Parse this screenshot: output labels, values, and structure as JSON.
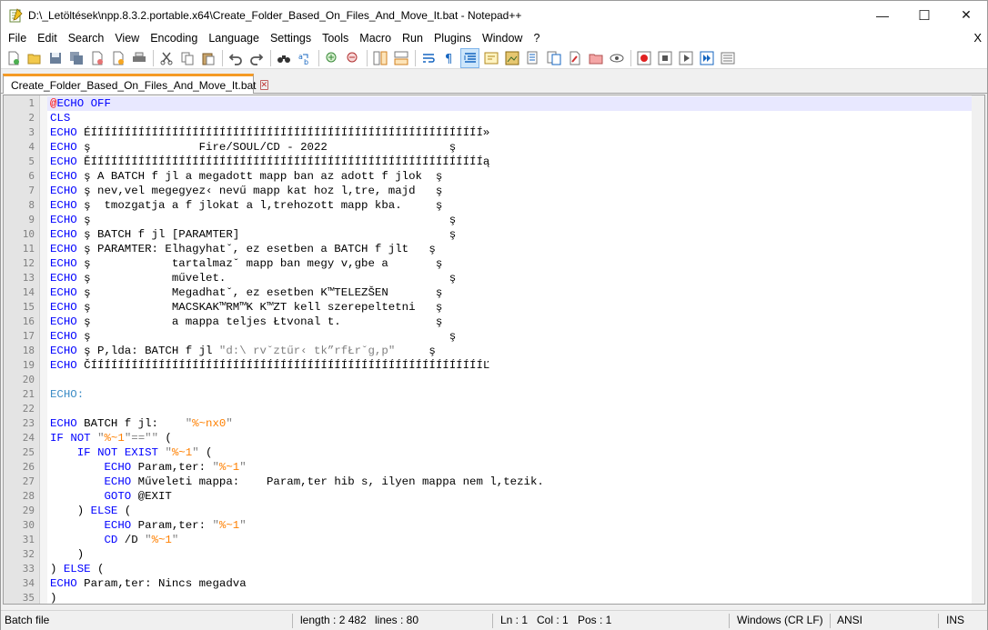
{
  "window": {
    "title": "D:\\_Letöltések\\npp.8.3.2.portable.x64\\Create_Folder_Based_On_Files_And_Move_It.bat - Notepad++",
    "minimize_glyph": "—",
    "maximize_glyph": "☐",
    "close_glyph": "✕"
  },
  "menu": {
    "items": [
      "File",
      "Edit",
      "Search",
      "View",
      "Encoding",
      "Language",
      "Settings",
      "Tools",
      "Macro",
      "Run",
      "Plugins",
      "Window",
      "?"
    ],
    "close_label": "X"
  },
  "toolbar": {
    "buttons": [
      "new",
      "open",
      "save",
      "save-all",
      "close",
      "close-all",
      "print",
      "cut",
      "copy",
      "paste",
      "undo",
      "redo",
      "find",
      "replace",
      "zoom-in",
      "zoom-out",
      "sync-v",
      "sync-h",
      "word-wrap",
      "all-chars",
      "indent-guide",
      "udl",
      "doc-map",
      "doc-list",
      "function-list",
      "folder-workspace",
      "monitoring",
      "record-macro",
      "stop-macro",
      "play-macro",
      "run-macro-multiple",
      "save-macro"
    ]
  },
  "tab": {
    "label": "Create_Folder_Based_On_Files_And_Move_It.bat",
    "close_glyph": "✕"
  },
  "editor": {
    "lines": [
      "@ECHO OFF",
      "CLS",
      "ECHO ÉÍÍÍÍÍÍÍÍÍÍÍÍÍÍÍÍÍÍÍÍÍÍÍÍÍÍÍÍÍÍÍÍÍÍÍÍÍÍÍÍÍÍÍÍÍÍÍÍÍÍÍÍÍÍÍÍÍÍ»",
      "ECHO ş                Fire/SOUL/CD - 2022                  ş",
      "ECHO ĚÍÍÍÍÍÍÍÍÍÍÍÍÍÍÍÍÍÍÍÍÍÍÍÍÍÍÍÍÍÍÍÍÍÍÍÍÍÍÍÍÍÍÍÍÍÍÍÍÍÍÍÍÍÍÍÍÍÍą",
      "ECHO ş A BATCH f jl a megadott mapp ban az adott f jlok  ş",
      "ECHO ş nev,vel megegyez‹ nevű mapp kat hoz l,tre, majd   ş",
      "ECHO ş  tmozgatja a f jlokat a l,trehozott mapp kba.     ş",
      "ECHO ş                                                     ş",
      "ECHO ş BATCH f jl [PARAMTER]                               ş",
      "ECHO ş PARAMTER: Elhagyhatˇ, ez esetben a BATCH f jlt   ş",
      "ECHO ş            tartalmazˇ mapp ban megy v,gbe a       ş",
      "ECHO ş            művelet.                                 ş",
      "ECHO ş            Megadhatˇ, ez esetben K™TELEZŠEN       ş",
      "ECHO ş            MACSKAK™RM™K K™ZT kell szerepeltetni   ş",
      "ECHO ş            a mappa teljes Łtvonal t.              ş",
      "ECHO ş                                                     ş",
      "ECHO ş P,lda: BATCH f jl \"d:\\ rvˇztűr‹ tk”rfŁrˇg,p\"     ş",
      "ECHO ČÍÍÍÍÍÍÍÍÍÍÍÍÍÍÍÍÍÍÍÍÍÍÍÍÍÍÍÍÍÍÍÍÍÍÍÍÍÍÍÍÍÍÍÍÍÍÍÍÍÍÍÍÍÍÍÍÍÍĽ",
      "",
      "ECHO:",
      "",
      "ECHO BATCH f jl:    \"%~nx0\"",
      "IF NOT \"%~1\"==\"\" (",
      "    IF NOT EXIST \"%~1\" (",
      "        ECHO Param,ter: \"%~1\"",
      "        ECHO Műveleti mappa:    Param,ter hib s, ilyen mappa nem l,tezik.",
      "        GOTO @EXIT",
      "    ) ELSE (",
      "        ECHO Param,ter: \"%~1\"",
      "        CD /D \"%~1\"",
      "    )",
      ") ELSE (",
      "ECHO Param,ter: Nincs megadva",
      ")"
    ]
  },
  "status": {
    "filetype": "Batch file",
    "length": "length : 2 482",
    "lines": "lines : 80",
    "ln": "Ln : 1",
    "col": "Col : 1",
    "pos": "Pos : 1",
    "eol": "Windows (CR LF)",
    "encoding": "ANSI",
    "mode": "INS"
  }
}
